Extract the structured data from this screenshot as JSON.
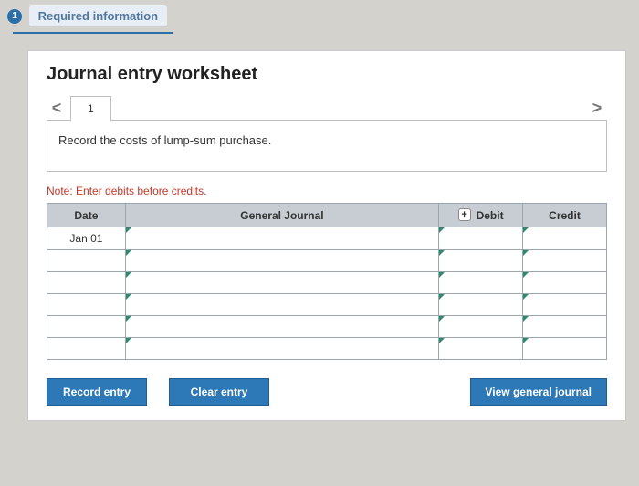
{
  "header": {
    "step_number": "1",
    "required_label": "Required information"
  },
  "worksheet": {
    "title": "Journal entry worksheet",
    "nav_prev": "<",
    "nav_next": ">",
    "tab_label": "1",
    "instruction": "Record the costs of lump-sum purchase.",
    "note": "Note: Enter debits before credits.",
    "columns": {
      "date": "Date",
      "general_journal": "General Journal",
      "debit": "Debit",
      "credit": "Credit"
    },
    "rows": [
      {
        "date": "Jan 01",
        "account": "",
        "debit": "",
        "credit": ""
      },
      {
        "date": "",
        "account": "",
        "debit": "",
        "credit": ""
      },
      {
        "date": "",
        "account": "",
        "debit": "",
        "credit": ""
      },
      {
        "date": "",
        "account": "",
        "debit": "",
        "credit": ""
      },
      {
        "date": "",
        "account": "",
        "debit": "",
        "credit": ""
      },
      {
        "date": "",
        "account": "",
        "debit": "",
        "credit": ""
      }
    ],
    "buttons": {
      "record": "Record entry",
      "clear": "Clear entry",
      "view": "View general journal"
    }
  }
}
